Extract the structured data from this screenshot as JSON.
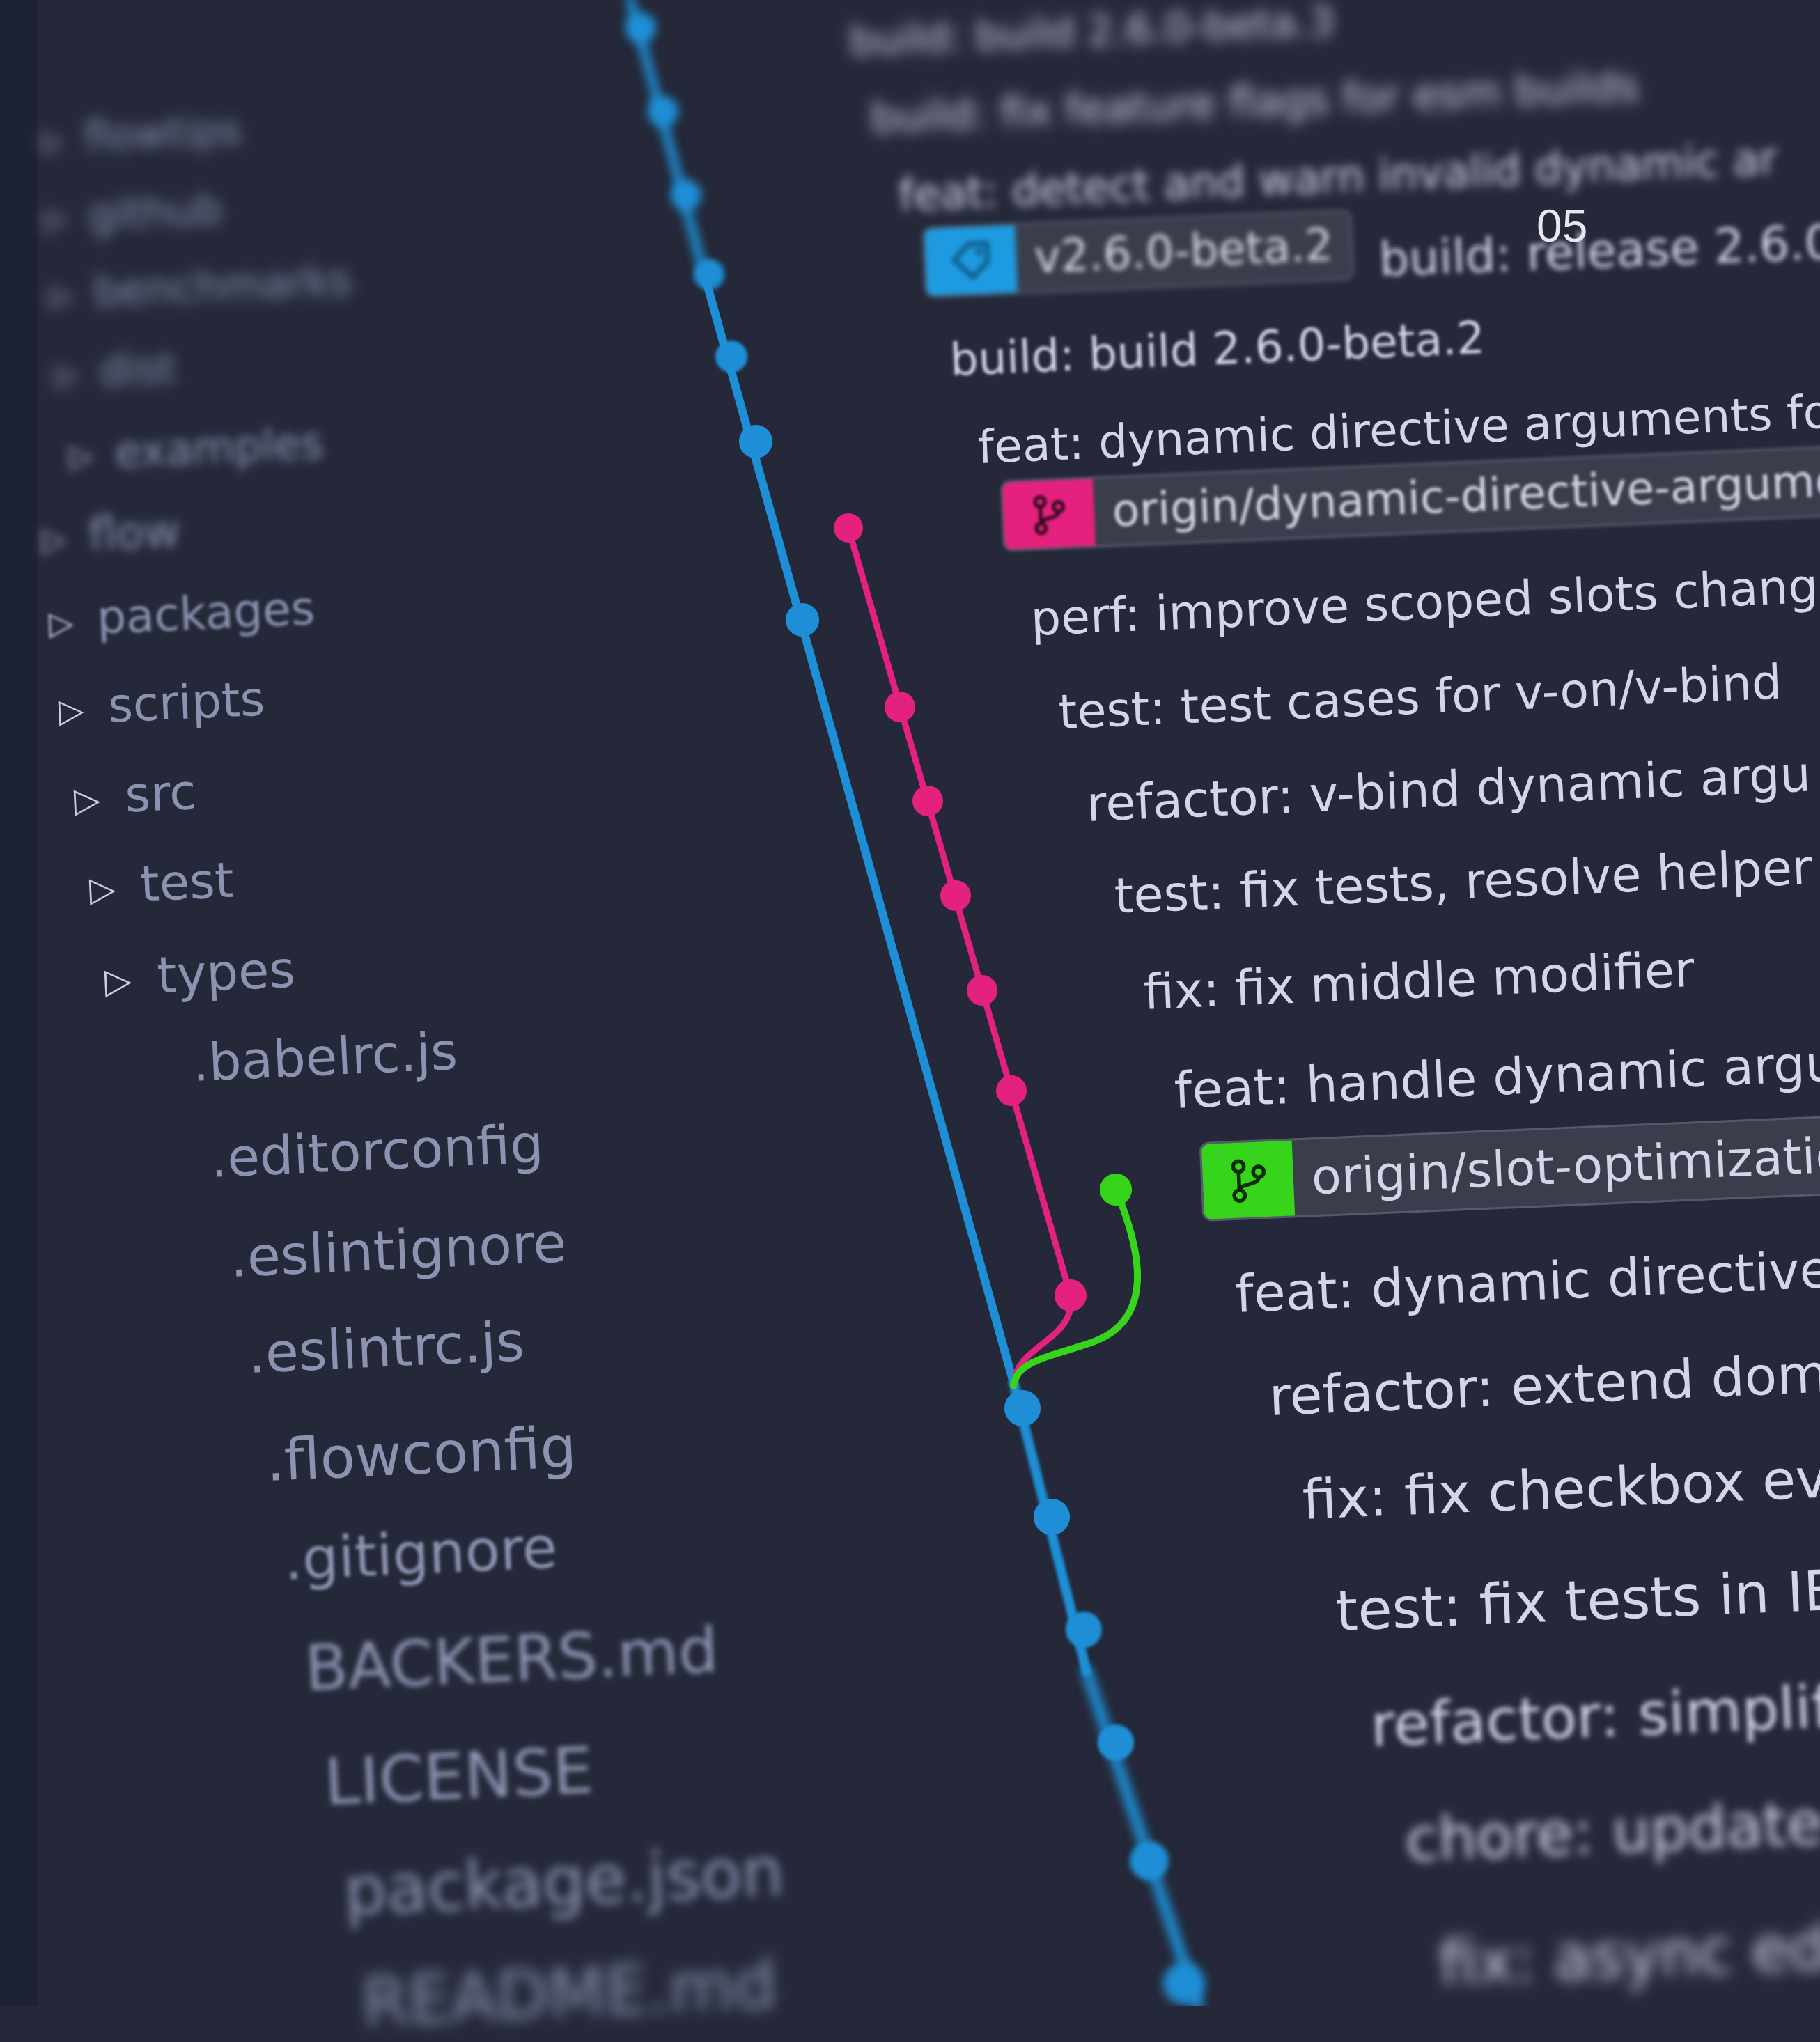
{
  "slide_number": "05",
  "file_tree": [
    {
      "label": "flowtips",
      "type": "folder",
      "expanded": false
    },
    {
      "label": "github",
      "type": "folder",
      "expanded": false
    },
    {
      "label": "benchmarks",
      "type": "folder",
      "expanded": false
    },
    {
      "label": "dist",
      "type": "folder",
      "expanded": false
    },
    {
      "label": "examples",
      "type": "folder",
      "expanded": false
    },
    {
      "label": "flow",
      "type": "folder",
      "expanded": false
    },
    {
      "label": "packages",
      "type": "folder",
      "expanded": false
    },
    {
      "label": "scripts",
      "type": "folder",
      "expanded": false
    },
    {
      "label": "src",
      "type": "folder",
      "expanded": false
    },
    {
      "label": "test",
      "type": "folder",
      "expanded": false
    },
    {
      "label": "types",
      "type": "folder",
      "expanded": false
    },
    {
      "label": ".babelrc.js",
      "type": "file"
    },
    {
      "label": ".editorconfig",
      "type": "file"
    },
    {
      "label": ".eslintignore",
      "type": "file"
    },
    {
      "label": ".eslintrc.js",
      "type": "file"
    },
    {
      "label": ".flowconfig",
      "type": "file"
    },
    {
      "label": ".gitignore",
      "type": "file"
    },
    {
      "label": "BACKERS.md",
      "type": "file"
    },
    {
      "label": "LICENSE",
      "type": "file"
    },
    {
      "label": "package.json",
      "type": "file"
    },
    {
      "label": "README.md",
      "type": "file"
    }
  ],
  "commits": [
    "build: build 2.6.0-beta.3",
    "build: fix feature flags for esm builds",
    "feat: detect and warn invalid dynamic ar",
    "build: build 2.6.0-beta.2",
    "feat: dynamic directive arguments fo",
    "perf: improve scoped slots chang",
    "test: test cases for v-on/v-bind",
    "refactor: v-bind dynamic argu",
    "test: fix tests, resolve helper",
    "fix: fix middle modifier",
    "feat: handle dynamic argu",
    "feat: dynamic directive",
    "refactor: extend dom",
    "fix: fix checkbox eve",
    "test: fix tests in IE/",
    "refactor: simplify",
    "chore: update c",
    "fix: async edg"
  ],
  "tags": {
    "release_tag": {
      "label": "v2.6.0-beta.2",
      "trailing_text": "build: release 2.6.0",
      "color": "#1e9be0",
      "icon": "tag-icon"
    },
    "branch_dynamic": {
      "label": "origin/dynamic-directive-argume",
      "color": "#e5217f",
      "icon": "git-branch-icon"
    },
    "branch_slot": {
      "label": "origin/slot-optimizatio",
      "color": "#36d51c",
      "icon": "git-branch-icon"
    }
  },
  "graph_colors": {
    "main": "#1e8fd6",
    "dynamic_branch": "#e5217f",
    "slot_branch": "#36d51c"
  }
}
